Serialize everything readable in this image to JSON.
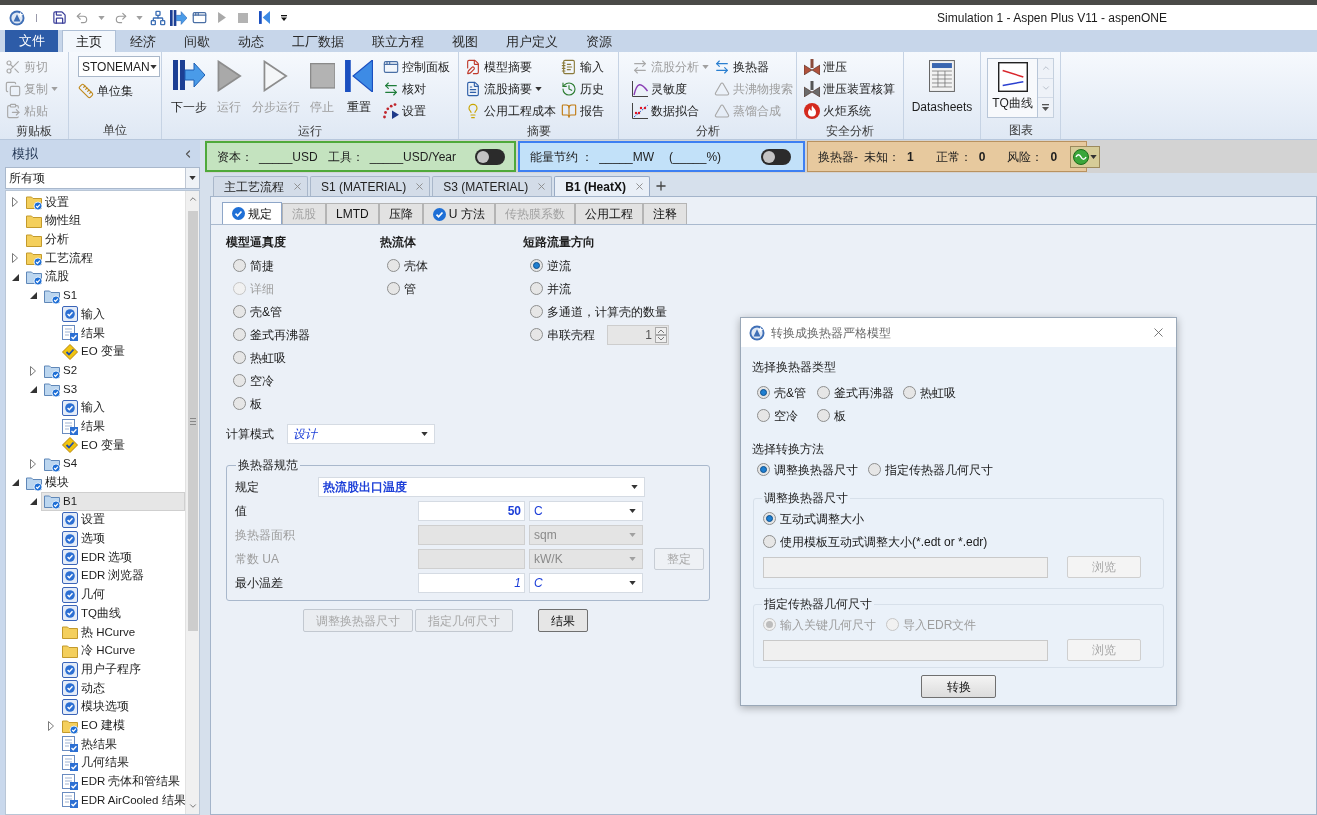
{
  "title_bar": {
    "title": "Simulation 1 - Aspen Plus V11 - aspenONE"
  },
  "ribbon": {
    "tabs": [
      {
        "label": "文件",
        "kind": "file",
        "selected": false
      },
      {
        "label": "主页",
        "kind": "tab",
        "selected": true
      },
      {
        "label": "经济",
        "kind": "tab",
        "selected": false
      },
      {
        "label": "间歇",
        "kind": "tab",
        "selected": false
      },
      {
        "label": "动态",
        "kind": "tab",
        "selected": false
      },
      {
        "label": "工厂数据",
        "kind": "tab",
        "selected": false
      },
      {
        "label": "联立方程",
        "kind": "tab",
        "selected": false
      },
      {
        "label": "视图",
        "kind": "tab",
        "selected": false
      },
      {
        "label": "用户定义",
        "kind": "tab",
        "selected": false
      },
      {
        "label": "资源",
        "kind": "tab",
        "selected": false
      }
    ],
    "groups": [
      {
        "label": "剪贴板",
        "columns": [
          [
            {
              "kind": "small",
              "label": "剪切",
              "disabled": true
            },
            {
              "kind": "small",
              "label": "复制",
              "disabled": true,
              "menu": true
            },
            {
              "kind": "small",
              "label": "粘贴",
              "disabled": true
            }
          ]
        ]
      },
      {
        "label": "单位",
        "columns": [
          [
            {
              "kind": "combo",
              "value": "STONEMAN"
            },
            {
              "kind": "small",
              "label": "单位集",
              "disabled": false
            }
          ]
        ]
      },
      {
        "label": "运行",
        "columns": [
          [
            {
              "kind": "large",
              "label": "下一步",
              "disabled": false
            }
          ],
          [
            {
              "kind": "large",
              "label": "运行",
              "disabled": true
            }
          ],
          [
            {
              "kind": "large",
              "label": "分步运行",
              "disabled": true
            }
          ],
          [
            {
              "kind": "large",
              "label": "停止",
              "disabled": true
            }
          ],
          [
            {
              "kind": "large",
              "label": "重置",
              "disabled": false
            }
          ],
          [
            {
              "kind": "small",
              "label": "控制面板",
              "disabled": false
            },
            {
              "kind": "small",
              "label": "核对",
              "disabled": false
            },
            {
              "kind": "small",
              "label": "设置",
              "disabled": false
            }
          ]
        ]
      },
      {
        "label": "摘要",
        "columns": [
          [
            {
              "kind": "small",
              "label": "模型摘要",
              "disabled": false
            },
            {
              "kind": "small",
              "label": "流股摘要",
              "disabled": false,
              "menu": true
            },
            {
              "kind": "small",
              "label": "公用工程成本",
              "disabled": false
            }
          ],
          [
            {
              "kind": "small",
              "label": "输入",
              "disabled": false
            },
            {
              "kind": "small",
              "label": "历史",
              "disabled": false
            },
            {
              "kind": "small",
              "label": "报告",
              "disabled": false
            }
          ]
        ]
      },
      {
        "label": "分析",
        "columns": [
          [
            {
              "kind": "small",
              "label": "流股分析",
              "disabled": true,
              "menu": true
            },
            {
              "kind": "small",
              "label": "灵敏度",
              "disabled": false
            },
            {
              "kind": "small",
              "label": "数据拟合",
              "disabled": false
            }
          ],
          [
            {
              "kind": "small",
              "label": "换热器",
              "disabled": false
            },
            {
              "kind": "small",
              "label": "共沸物搜索",
              "disabled": true
            },
            {
              "kind": "small",
              "label": "蒸馏合成",
              "disabled": true
            }
          ]
        ]
      },
      {
        "label": "安全分析",
        "columns": [
          [
            {
              "kind": "small",
              "label": "泄压",
              "disabled": false
            },
            {
              "kind": "small",
              "label": "泄压装置核算",
              "disabled": false
            },
            {
              "kind": "small",
              "label": "火炬系统",
              "disabled": false
            }
          ]
        ]
      },
      {
        "columns": [
          [
            {
              "kind": "large",
              "label": "Datasheets",
              "disabled": false
            }
          ]
        ]
      },
      {
        "label": "图表",
        "columns": [
          [
            {
              "kind": "gallery",
              "label": "TQ曲线"
            }
          ]
        ]
      }
    ]
  },
  "indicators": [
    {
      "kind": "cost",
      "fields": [
        {
          "label": "资本：",
          "value": "_____USD"
        },
        {
          "label": "工具：",
          "value": "_____USD/Year"
        }
      ],
      "on": false
    },
    {
      "kind": "energy",
      "fields": [
        {
          "label": "能量节约 ：",
          "value": "_____MW"
        },
        {
          "value": "(_____%)"
        }
      ],
      "on": false
    },
    {
      "kind": "exchangers",
      "label": "换热器-",
      "counts": [
        {
          "label": "未知：",
          "value": "1"
        },
        {
          "label": "正常：",
          "value": "0"
        },
        {
          "label": "风险：",
          "value": "0"
        }
      ]
    }
  ],
  "navigator": {
    "title": "模拟",
    "filter": "所有项",
    "tree": [
      {
        "label": "设置",
        "kind": "folder",
        "complete": true,
        "expanded": false,
        "selected": false
      },
      {
        "label": "物性组",
        "kind": "folder",
        "complete": false,
        "selected": false
      },
      {
        "label": "分析",
        "kind": "folder",
        "complete": false,
        "selected": false
      },
      {
        "label": "工艺流程",
        "kind": "folder",
        "complete": true,
        "expanded": false,
        "selected": false
      },
      {
        "label": "流股",
        "kind": "object",
        "complete": true,
        "expanded": true,
        "selected": false,
        "children": [
          {
            "label": "S1",
            "kind": "object",
            "complete": true,
            "expanded": true,
            "selected": false,
            "children": [
              {
                "label": "输入",
                "kind": "form",
                "complete": true,
                "selected": false
              },
              {
                "label": "结果",
                "kind": "results",
                "complete": true,
                "selected": false
              },
              {
                "label": "EO 变量",
                "kind": "variables",
                "complete": true,
                "selected": false
              }
            ]
          },
          {
            "label": "S2",
            "kind": "object",
            "complete": true,
            "expanded": false,
            "selected": false
          },
          {
            "label": "S3",
            "kind": "object",
            "complete": true,
            "expanded": true,
            "selected": false,
            "children": [
              {
                "label": "输入",
                "kind": "form",
                "complete": true,
                "selected": false
              },
              {
                "label": "结果",
                "kind": "results",
                "complete": true,
                "selected": false
              },
              {
                "label": "EO 变量",
                "kind": "variables",
                "complete": true,
                "selected": false
              }
            ]
          },
          {
            "label": "S4",
            "kind": "object",
            "complete": true,
            "expanded": false,
            "selected": false
          }
        ]
      },
      {
        "label": "模块",
        "kind": "object",
        "complete": true,
        "expanded": true,
        "selected": false,
        "children": [
          {
            "label": "B1",
            "kind": "object",
            "complete": true,
            "expanded": true,
            "selected": true,
            "children": [
              {
                "label": "设置",
                "kind": "form",
                "complete": true,
                "selected": false
              },
              {
                "label": "选项",
                "kind": "form",
                "complete": true,
                "selected": false
              },
              {
                "label": "EDR 选项",
                "kind": "form",
                "complete": true,
                "selected": false
              },
              {
                "label": "EDR 浏览器",
                "kind": "form",
                "complete": true,
                "selected": false
              },
              {
                "label": "几何",
                "kind": "form",
                "complete": true,
                "selected": false
              },
              {
                "label": "TQ曲线",
                "kind": "form",
                "complete": true,
                "selected": false
              },
              {
                "label": "热 HCurve",
                "kind": "folder",
                "complete": false,
                "selected": false
              },
              {
                "label": "冷 HCurve",
                "kind": "folder",
                "complete": false,
                "selected": false
              },
              {
                "label": "用户子程序",
                "kind": "form",
                "complete": true,
                "selected": false
              },
              {
                "label": "动态",
                "kind": "form",
                "complete": true,
                "selected": false
              },
              {
                "label": "模块选项",
                "kind": "form",
                "complete": true,
                "selected": false
              },
              {
                "label": "EO 建模",
                "kind": "folder",
                "complete": true,
                "expanded": false,
                "selected": false
              },
              {
                "label": "热结果",
                "kind": "results",
                "complete": true,
                "selected": false
              },
              {
                "label": "几何结果",
                "kind": "results",
                "complete": true,
                "selected": false
              },
              {
                "label": "EDR 壳体和管结果",
                "kind": "results",
                "complete": true,
                "selected": false
              },
              {
                "label": "EDR AirCooled 结果",
                "kind": "results",
                "complete": true,
                "selected": false
              }
            ]
          }
        ]
      }
    ]
  },
  "document_tabs": [
    {
      "label": "主工艺流程",
      "selected": false
    },
    {
      "label": "S1 (MATERIAL)",
      "selected": false
    },
    {
      "label": "S3 (MATERIAL)",
      "selected": false
    },
    {
      "label": "B1 (HeatX)",
      "selected": true
    }
  ],
  "form": {
    "tabs": [
      {
        "label": "规定",
        "selected": true,
        "complete": true,
        "disabled": false
      },
      {
        "label": "流股",
        "selected": false,
        "complete": false,
        "disabled": true
      },
      {
        "label": "LMTD",
        "selected": false,
        "complete": false,
        "disabled": false
      },
      {
        "label": "压降",
        "selected": false,
        "complete": false,
        "disabled": false
      },
      {
        "label": "U 方法",
        "selected": false,
        "complete": true,
        "disabled": false
      },
      {
        "label": "传热膜系数",
        "selected": false,
        "complete": false,
        "disabled": true
      },
      {
        "label": "公用工程",
        "selected": false,
        "complete": false,
        "disabled": false
      },
      {
        "label": "注释",
        "selected": false,
        "complete": false,
        "disabled": false
      }
    ],
    "option_groups": [
      {
        "title": "模型逼真度",
        "options": [
          {
            "label": "简捷",
            "selected": false,
            "disabled": false
          },
          {
            "label": "详细",
            "selected": false,
            "disabled": true
          },
          {
            "label": "壳&管",
            "selected": false,
            "disabled": false
          },
          {
            "label": "釜式再沸器",
            "selected": false,
            "disabled": false
          },
          {
            "label": "热虹吸",
            "selected": false,
            "disabled": false
          },
          {
            "label": "空冷",
            "selected": false,
            "disabled": false
          },
          {
            "label": "板",
            "selected": false,
            "disabled": false
          }
        ]
      },
      {
        "title": "热流体",
        "options": [
          {
            "label": "壳体",
            "selected": false
          },
          {
            "label": "管",
            "selected": false
          }
        ]
      },
      {
        "title": "短路流量方向",
        "options": [
          {
            "label": "逆流",
            "selected": true
          },
          {
            "label": "并流",
            "selected": false
          },
          {
            "label": "多通道，计算壳的数量",
            "selected": false
          },
          {
            "label": "串联壳程",
            "selected": false,
            "spinner": {
              "value": "1",
              "disabled": true
            }
          }
        ]
      }
    ],
    "calculation_mode": {
      "label": "计算模式",
      "value": "设计",
      "entered": false
    },
    "spec": {
      "title": "换热器规范",
      "rows": [
        {
          "kind": "select",
          "label": "规定",
          "value": "热流股出口温度",
          "entered": true
        },
        {
          "kind": "quantity",
          "label": "值",
          "value": "50",
          "unit": "C",
          "entered": true,
          "disabled": false
        },
        {
          "kind": "quantity",
          "label": "换热器面积",
          "unit": "sqm",
          "disabled": true
        },
        {
          "kind": "quantity",
          "label": "常数 UA",
          "unit": "kW/K",
          "disabled": true,
          "button": {
            "label": "整定",
            "disabled": true
          }
        },
        {
          "kind": "quantity",
          "label": "最小温差",
          "value": "1",
          "unit": "C",
          "entered": false,
          "disabled": false
        }
      ]
    },
    "buttons": [
      {
        "label": "调整换热器尺寸",
        "disabled": true
      },
      {
        "label": "指定几何尺寸",
        "disabled": true
      },
      {
        "label": "结果",
        "disabled": false
      }
    ]
  },
  "dialog": {
    "title": "转换成换热器严格模型",
    "sections": [
      {
        "label": "选择换热器类型",
        "kind": "grid",
        "options": [
          {
            "label": "壳&管",
            "selected": true
          },
          {
            "label": "釜式再沸器",
            "selected": false
          },
          {
            "label": "热虹吸",
            "selected": false
          },
          {
            "label": "空冷",
            "selected": false
          },
          {
            "label": "板",
            "selected": false
          }
        ]
      },
      {
        "label": "选择转换方法",
        "kind": "row",
        "options": [
          {
            "label": "调整换热器尺寸",
            "selected": true
          },
          {
            "label": "指定传热器几何尺寸",
            "selected": false
          }
        ]
      }
    ],
    "groups": [
      {
        "title": "调整换热器尺寸",
        "kind": "stack",
        "options": [
          {
            "label": "互动式调整大小",
            "selected": true,
            "disabled": false
          },
          {
            "label": "使用模板互动式调整大小(*.edt or *.edr)",
            "selected": false,
            "disabled": false
          }
        ],
        "path_field": {
          "disabled": true
        },
        "browse": {
          "label": "浏览",
          "disabled": true
        }
      },
      {
        "title": "指定传热器几何尺寸",
        "kind": "row",
        "options": [
          {
            "label": "输入关键几何尺寸",
            "selected": true,
            "disabled": true
          },
          {
            "label": "导入EDR文件",
            "selected": false,
            "disabled": true
          }
        ],
        "path_field": {
          "disabled": true
        },
        "browse": {
          "label": "浏览",
          "disabled": true
        }
      }
    ],
    "button": "转换"
  }
}
